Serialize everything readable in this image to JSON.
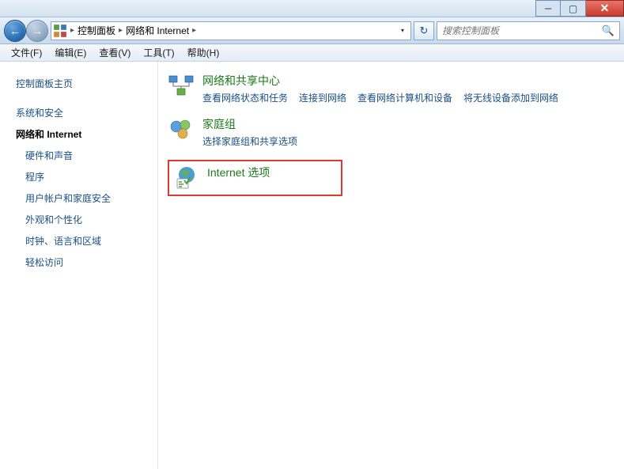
{
  "titlebar": {
    "min": "–",
    "max": "▢",
    "close": "✕"
  },
  "nav": {
    "back": "←",
    "forward": "→",
    "breadcrumbs": [
      "控制面板",
      "网络和 Internet"
    ],
    "refresh": "↻",
    "search_placeholder": "搜索控制面板",
    "search_icon": "🔍"
  },
  "menu": [
    "文件(F)",
    "编辑(E)",
    "查看(V)",
    "工具(T)",
    "帮助(H)"
  ],
  "sidebar": {
    "items": [
      {
        "label": "控制面板主页",
        "active": false,
        "sub": false
      },
      {
        "label": "系统和安全",
        "active": false,
        "sub": false
      },
      {
        "label": "网络和 Internet",
        "active": true,
        "sub": false
      },
      {
        "label": "硬件和声音",
        "active": false,
        "sub": true
      },
      {
        "label": "程序",
        "active": false,
        "sub": true
      },
      {
        "label": "用户帐户和家庭安全",
        "active": false,
        "sub": true
      },
      {
        "label": "外观和个性化",
        "active": false,
        "sub": true
      },
      {
        "label": "时钟、语言和区域",
        "active": false,
        "sub": true
      },
      {
        "label": "轻松访问",
        "active": false,
        "sub": true
      }
    ]
  },
  "content": {
    "categories": [
      {
        "title": "网络和共享中心",
        "links": [
          "查看网络状态和任务",
          "连接到网络",
          "查看网络计算机和设备",
          "将无线设备添加到网络"
        ],
        "highlighted": false
      },
      {
        "title": "家庭组",
        "links": [
          "选择家庭组和共享选项"
        ],
        "highlighted": false
      },
      {
        "title": "Internet 选项",
        "links": [],
        "highlighted": true
      }
    ]
  }
}
